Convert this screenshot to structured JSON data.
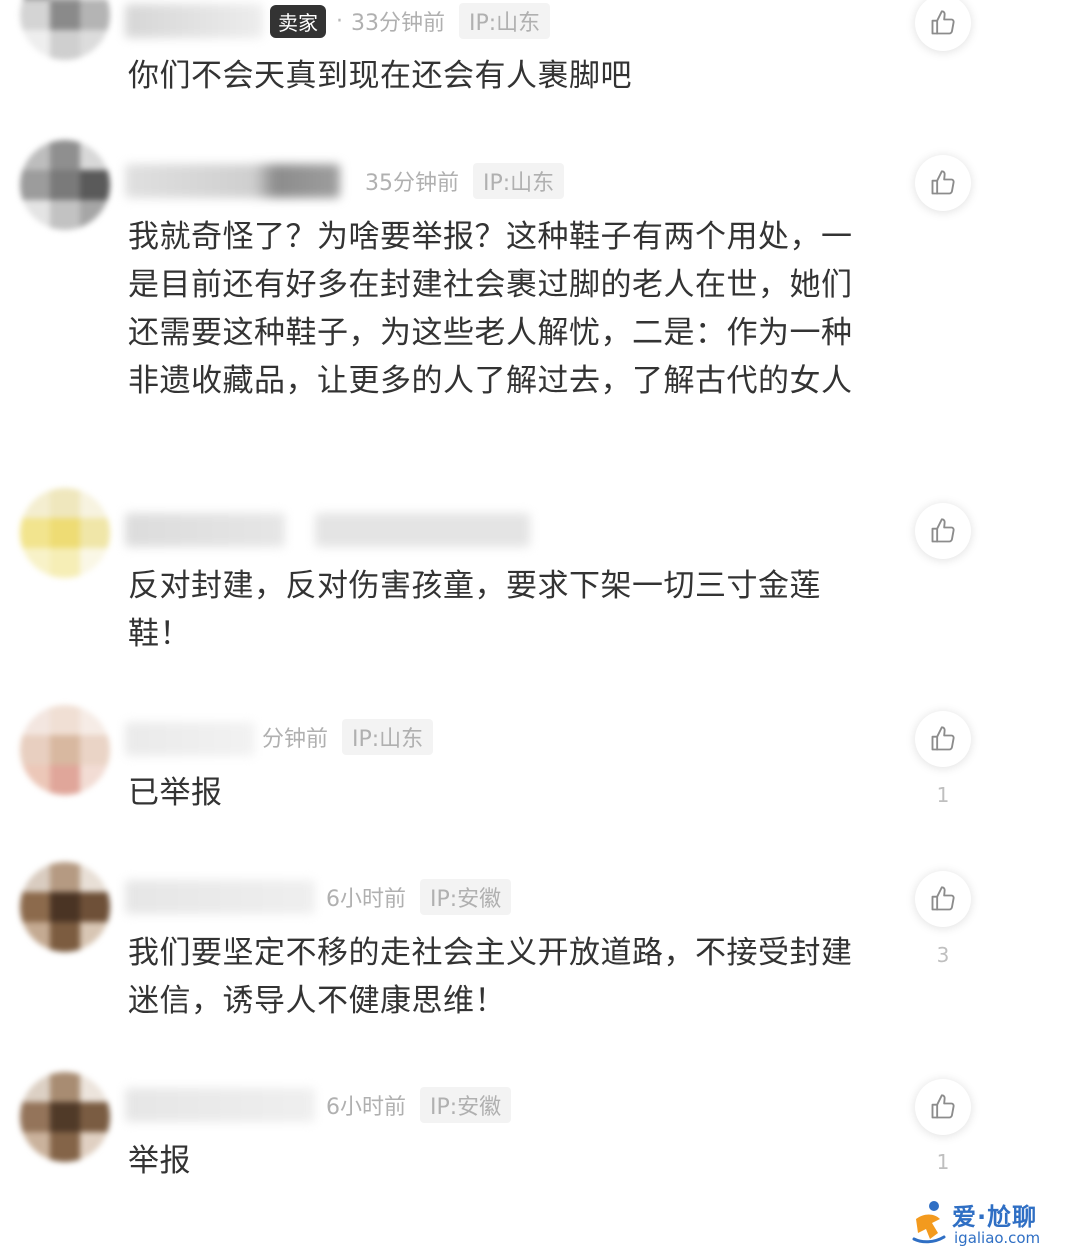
{
  "comments": [
    {
      "badge": "卖家",
      "time": "33分钟前",
      "ip": "IP:山东",
      "text": "你们不会天真到现在还会有人裹脚吧",
      "like_count": ""
    },
    {
      "badge": "",
      "time": "35分钟前",
      "ip": "IP:山东",
      "text": "我就奇怪了？为啥要举报？这种鞋子有两个用处，一是目前还有好多在封建社会裹过脚的老人在世，她们还需要这种鞋子，为这些老人解忧，二是：作为一种非遗收藏品，让更多的人了解过去，了解古代的女人",
      "like_count": ""
    },
    {
      "badge": "",
      "time": "",
      "ip": "",
      "text": "反对封建，反对伤害孩童，要求下架一切三寸金莲鞋！",
      "like_count": ""
    },
    {
      "badge": "",
      "time": "分钟前",
      "ip": "IP:山东",
      "text": "已举报",
      "like_count": "1"
    },
    {
      "badge": "",
      "time": "6小时前",
      "ip": "IP:安徽",
      "text": "我们要坚定不移的走社会主义开放道路，不接受封建迷信，诱导人不健康思维！",
      "like_count": "3"
    },
    {
      "badge": "",
      "time": "6小时前",
      "ip": "IP:安徽",
      "text": "举报",
      "like_count": "1"
    }
  ],
  "meta_dot": "·",
  "icons": {
    "like": "thumbs-up-icon",
    "watermark_logo": "running-figure-logo-icon"
  },
  "watermark": {
    "title": "爱·尬聊",
    "url": "igaliao.com"
  },
  "colors": {
    "text": "#333333",
    "meta": "#b0b0b0",
    "badge_bg": "#333333",
    "ip_bg": "#f3f3f3",
    "watermark_blue": "#2f6fc4",
    "watermark_orange": "#f39a1e"
  }
}
